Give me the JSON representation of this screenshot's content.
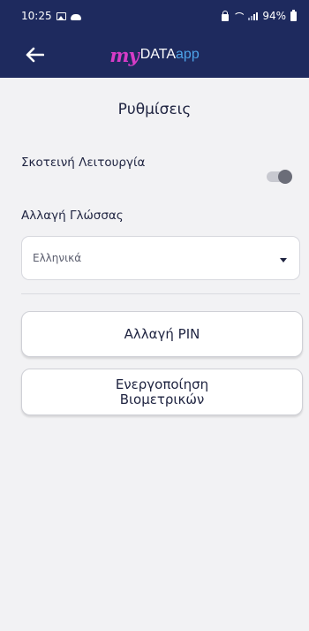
{
  "status_bar": {
    "time": "10:25",
    "battery": "94%"
  },
  "header": {
    "logo_my": "my",
    "logo_data": "DATA",
    "logo_app": "app"
  },
  "settings": {
    "title": "Ρυθμίσεις",
    "dark_mode_label": "Σκοτεινή Λειτουργία",
    "dark_mode_enabled": false,
    "language_label": "Αλλαγή Γλώσσας",
    "language_value": "Ελληνικά",
    "change_pin_label": "Αλλαγή PIN",
    "biometrics_label": "Ενεργοποίηση Βιομετρικών"
  },
  "colors": {
    "primary": "#1e2a5e",
    "logo_my": "#d63cc7",
    "logo_app": "#4da3e8",
    "background": "#f2f2f4"
  },
  "icons": [
    "gallery-icon",
    "cloud-icon",
    "lock-icon",
    "wifi-icon",
    "signal-icon",
    "battery-icon",
    "back-arrow-icon",
    "chevron-down-icon"
  ]
}
